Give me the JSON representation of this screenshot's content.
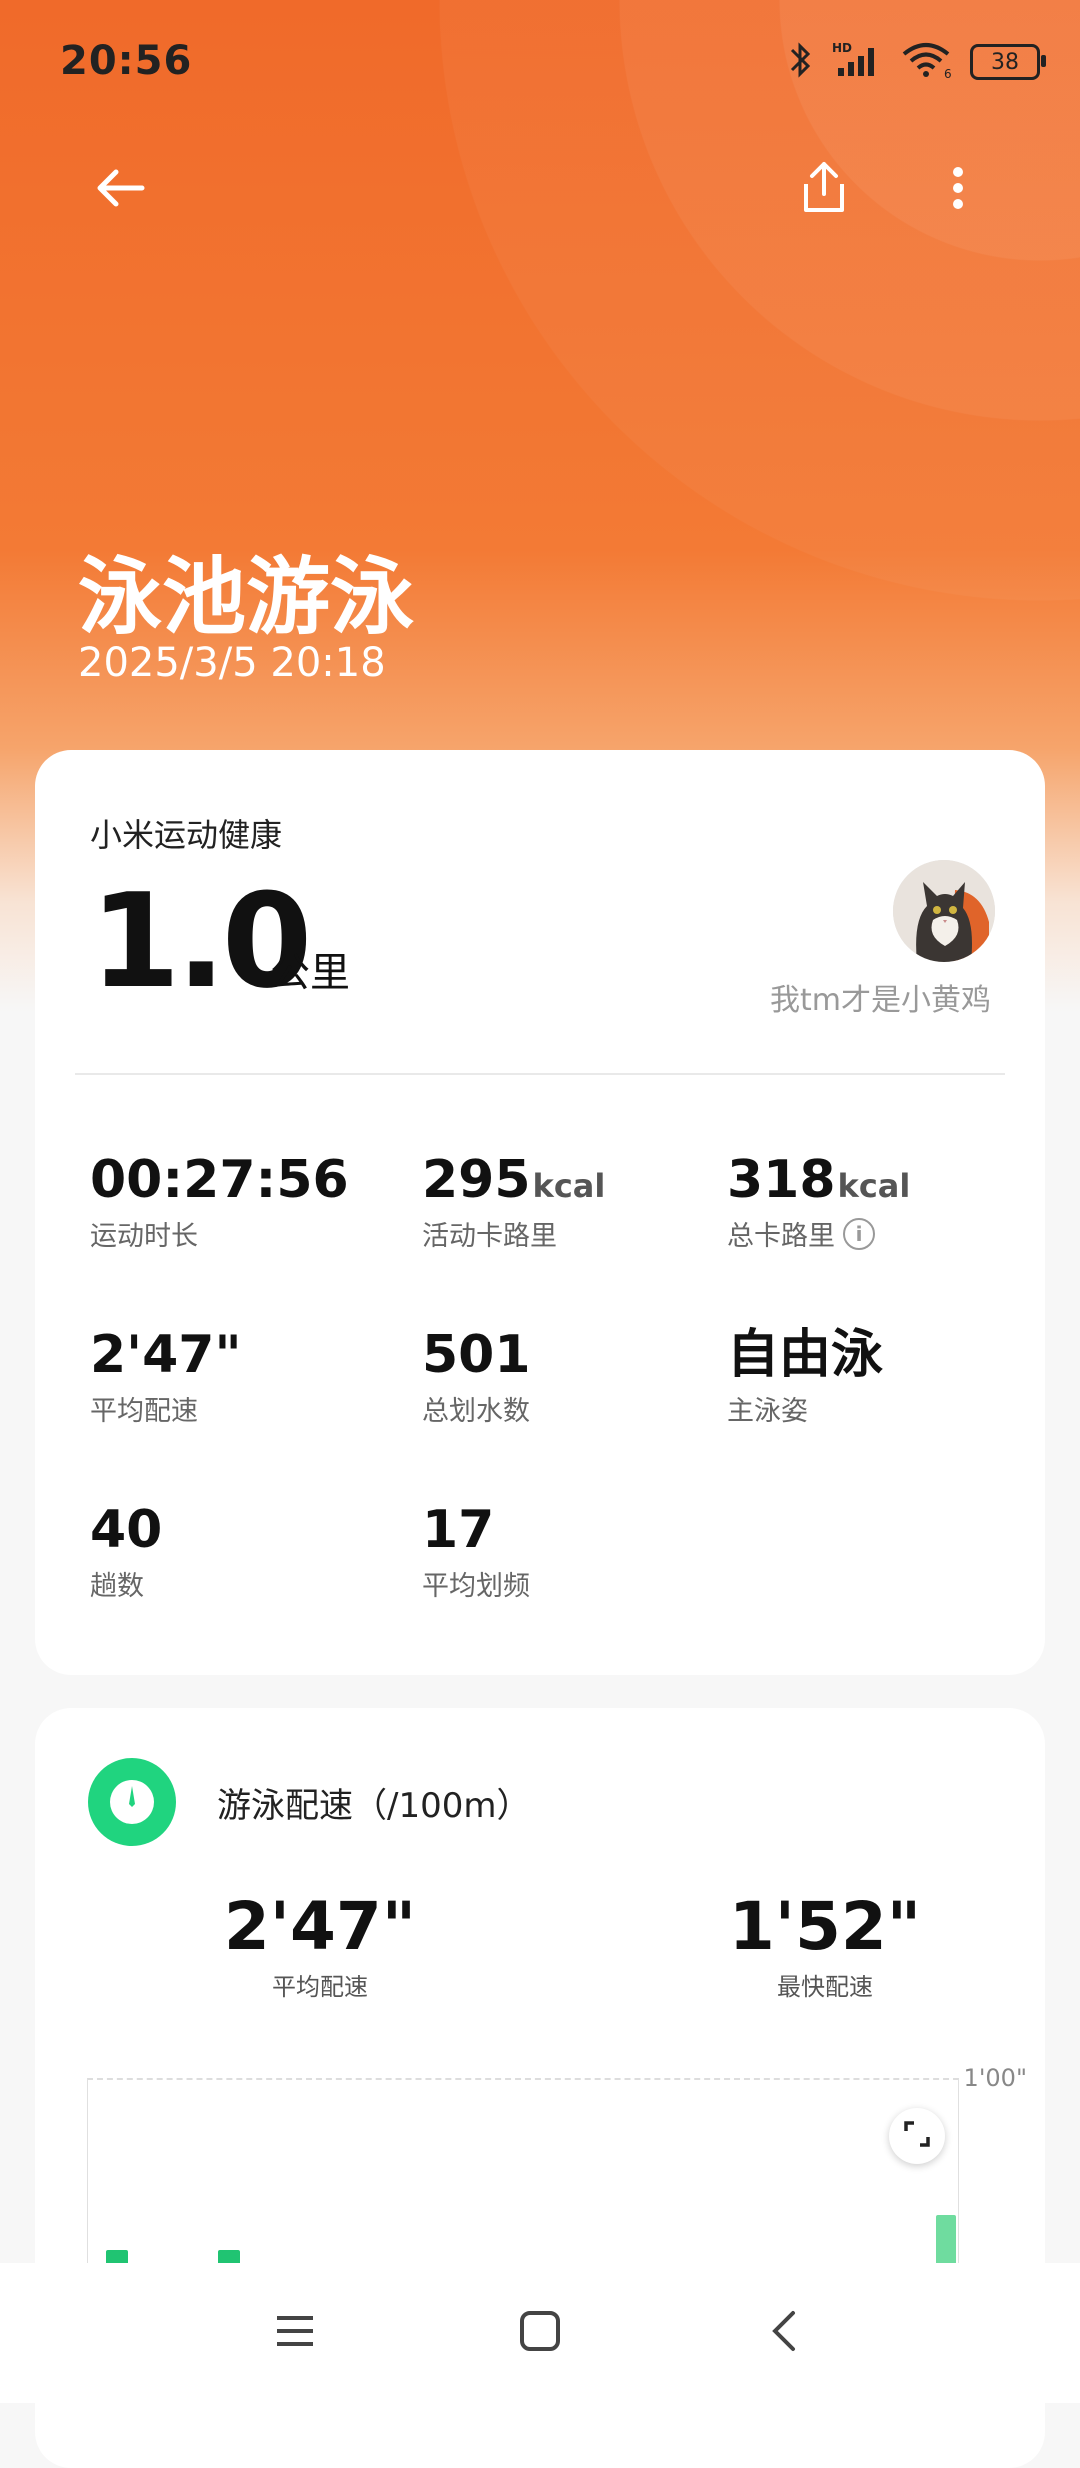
{
  "status_bar": {
    "time": "20:56",
    "battery": "38"
  },
  "header": {
    "title": "泳池游泳",
    "datetime": "2025/3/5 20:18"
  },
  "summary": {
    "brand": "小米运动健康",
    "distance": "1.0",
    "distance_unit": "公里",
    "username": "我tm才是小黄鸡"
  },
  "metrics": [
    {
      "value": "00:27:56",
      "unit": "",
      "label": "运动时长"
    },
    {
      "value": "295",
      "unit": "kcal",
      "label": "活动卡路里"
    },
    {
      "value": "318",
      "unit": "kcal",
      "label": "总卡路里"
    },
    {
      "value": "2'47\"",
      "unit": "",
      "label": "平均配速"
    },
    {
      "value": "501",
      "unit": "",
      "label": "总划水数"
    },
    {
      "value": "自由泳",
      "unit": "",
      "label": "主泳姿"
    },
    {
      "value": "40",
      "unit": "",
      "label": "趟数"
    },
    {
      "value": "17",
      "unit": "",
      "label": "平均划频"
    }
  ],
  "pace_section": {
    "title": "游泳配速（/100m）",
    "avg_value": "2'47\"",
    "avg_label": "平均配速",
    "best_value": "1'52\"",
    "best_label": "最快配速",
    "axis_label": "1'00\""
  },
  "icons": {
    "back": "arrow-left-icon",
    "share": "share-icon",
    "more": "more-vertical-icon",
    "info": "info-icon",
    "pace": "swim-pace-icon",
    "expand": "expand-icon",
    "nav_menu": "menu-icon",
    "nav_home": "home-icon",
    "nav_back": "back-icon"
  },
  "colors": {
    "accent_orange": "#f06a2a",
    "accent_green": "#20d47f"
  }
}
